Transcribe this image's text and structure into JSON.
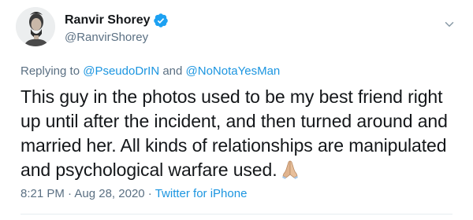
{
  "author": {
    "display_name": "Ranvir Shorey",
    "handle": "@RanvirShorey",
    "verified": true
  },
  "reply": {
    "prefix": "Replying to ",
    "mention_1": "@PseudoDrIN",
    "conjunction": " and ",
    "mention_2": "@NoNotaYesMan"
  },
  "tweet": {
    "text": "This guy in the photos used to be my best friend right up until after the incident, and then turned around and married her. All kinds of relationships are manipulated and psychological warfare used.",
    "emoji": "folded-hands-emoji"
  },
  "meta": {
    "time": "8:21 PM",
    "separator_1": " · ",
    "date": "Aug 28, 2020",
    "separator_2": " · ",
    "source": "Twitter for iPhone"
  },
  "colors": {
    "link": "#1b95e0",
    "secondary_text": "#5b7083",
    "verified_badge": "#1da1f2"
  },
  "icons": [
    "verified-badge-icon",
    "chevron-down-icon",
    "folded-hands-emoji"
  ]
}
